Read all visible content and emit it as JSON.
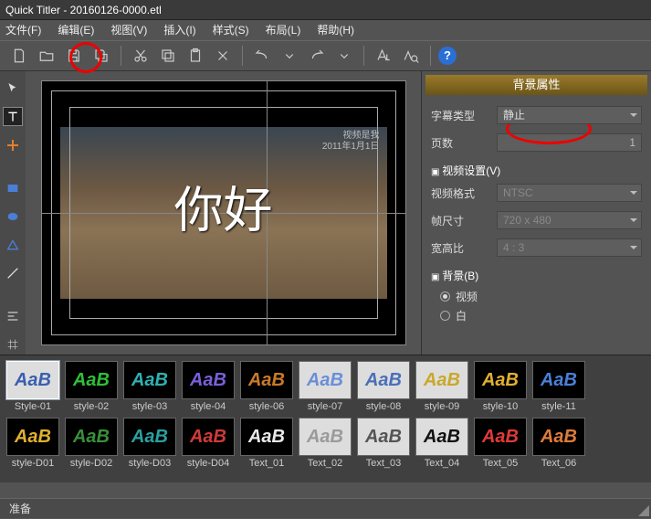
{
  "window": {
    "title": "Quick Titler - 20160126-0000.etl"
  },
  "menus": {
    "file": "文件(F)",
    "edit": "编辑(E)",
    "view": "视图(V)",
    "insert": "插入(I)",
    "style": "样式(S)",
    "layout": "布局(L)",
    "help": "帮助(H)"
  },
  "toolbar": {
    "help_glyph": "?"
  },
  "canvas": {
    "text": "你好",
    "watermark_line1": "视频是我",
    "watermark_line2": "2011年1月1日"
  },
  "props": {
    "header": "背景属性",
    "subtitle_type_label": "字幕类型",
    "subtitle_type_value": "静止",
    "pages_label": "页数",
    "pages_value": "1",
    "video_settings_section": "视频设置(V)",
    "video_format_label": "视频格式",
    "video_format_value": "NTSC",
    "frame_size_label": "帧尺寸",
    "frame_size_value": "720 x 480",
    "aspect_label": "宽高比",
    "aspect_value": "4 : 3",
    "background_section": "背景(B)",
    "radio_video": "视频",
    "radio_white": "白"
  },
  "styles_row1": [
    {
      "label": "Style-01",
      "text": "AaB",
      "bg": "light",
      "color": "#3a5fb0",
      "sel": true
    },
    {
      "label": "style-02",
      "text": "AaB",
      "bg": "dark",
      "color": "#2fbf3a"
    },
    {
      "label": "style-03",
      "text": "AaB",
      "bg": "dark",
      "color": "#2fb0b0"
    },
    {
      "label": "style-04",
      "text": "AaB",
      "bg": "dark",
      "color": "#7a5fd8"
    },
    {
      "label": "style-06",
      "text": "AaB",
      "bg": "dark",
      "color": "#c97a2a"
    },
    {
      "label": "style-07",
      "text": "AaB",
      "bg": "light",
      "color": "#6a8fd8"
    },
    {
      "label": "style-08",
      "text": "AaB",
      "bg": "light",
      "color": "#4a6fb8"
    },
    {
      "label": "style-09",
      "text": "AaB",
      "bg": "light",
      "color": "#c9a82a"
    },
    {
      "label": "style-10",
      "text": "AaB",
      "bg": "dark",
      "color": "#e0b030"
    },
    {
      "label": "style-11",
      "text": "AaB",
      "bg": "dark",
      "color": "#4a7fd8"
    }
  ],
  "styles_row2": [
    {
      "label": "style-D01",
      "text": "AaB",
      "bg": "dark",
      "color": "#e0b030"
    },
    {
      "label": "style-D02",
      "text": "AaB",
      "bg": "dark",
      "color": "#3a8f3a"
    },
    {
      "label": "style-D03",
      "text": "AaB",
      "bg": "dark",
      "color": "#2aa0a0"
    },
    {
      "label": "style-D04",
      "text": "AaB",
      "bg": "dark",
      "color": "#d03a3a"
    },
    {
      "label": "Text_01",
      "text": "AaB",
      "bg": "dark",
      "color": "#e8e8e8"
    },
    {
      "label": "Text_02",
      "text": "AaB",
      "bg": "light",
      "color": "#9a9a9a"
    },
    {
      "label": "Text_03",
      "text": "AaB",
      "bg": "light",
      "color": "#555"
    },
    {
      "label": "Text_04",
      "text": "AaB",
      "bg": "light",
      "color": "#111"
    },
    {
      "label": "Text_05",
      "text": "AaB",
      "bg": "dark",
      "color": "#e03a3a"
    },
    {
      "label": "Text_06",
      "text": "AaB",
      "bg": "dark",
      "color": "#e07a3a"
    }
  ],
  "status": {
    "text": "准备"
  }
}
